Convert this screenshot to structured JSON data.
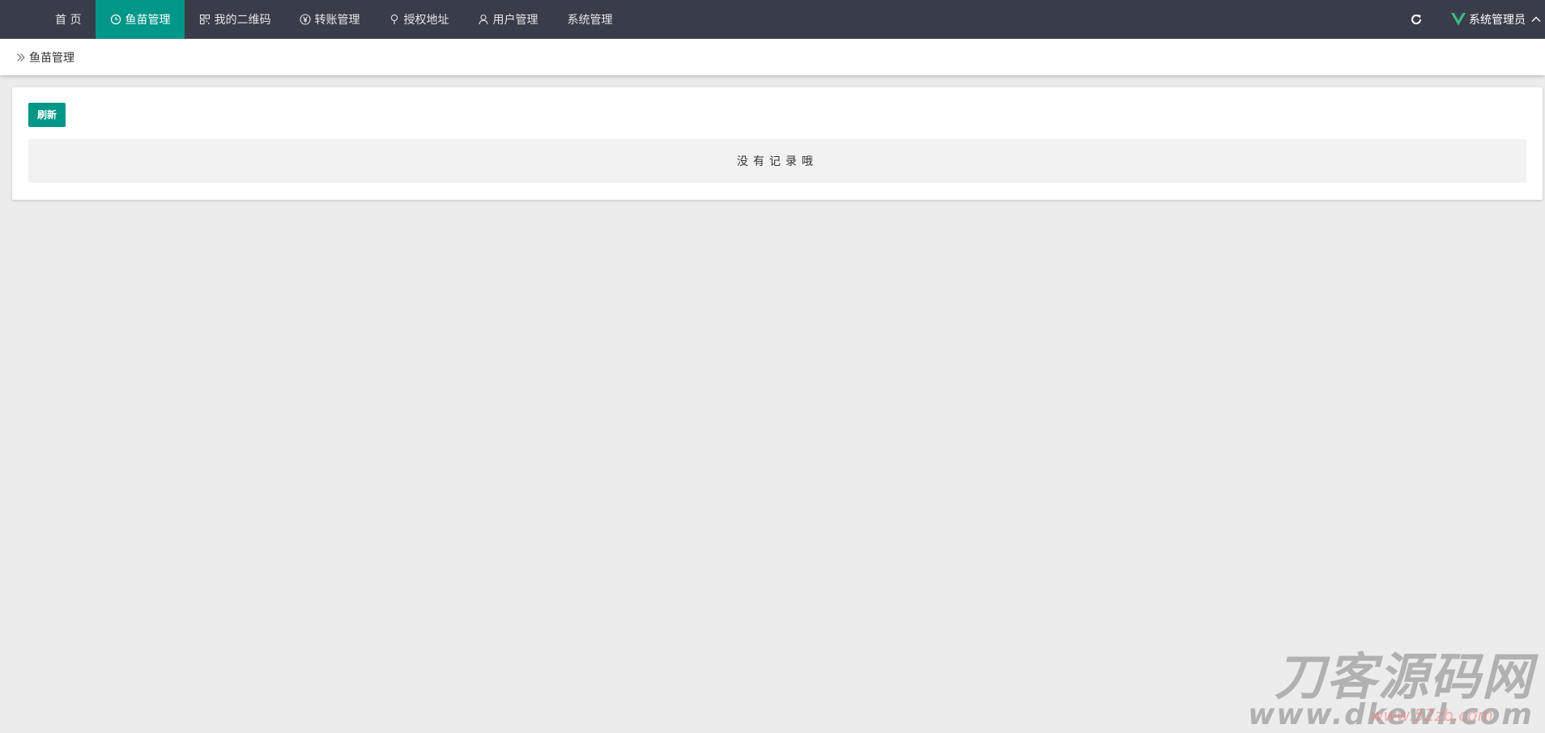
{
  "nav": {
    "items": [
      {
        "label": "首 页",
        "icon": "none"
      },
      {
        "label": "鱼苗管理",
        "icon": "clock-icon",
        "active": true
      },
      {
        "label": "我的二维码",
        "icon": "qrcode-icon"
      },
      {
        "label": "转账管理",
        "icon": "yen-icon"
      },
      {
        "label": "授权地址",
        "icon": "location-icon"
      },
      {
        "label": "用户管理",
        "icon": "user-icon"
      },
      {
        "label": "系统管理",
        "icon": "none"
      }
    ]
  },
  "user": {
    "name": "系统管理员"
  },
  "breadcrumb": {
    "current": "鱼苗管理"
  },
  "toolbar": {
    "refresh_label": "刷新"
  },
  "table": {
    "empty_text": "没有记录哦"
  },
  "watermark": {
    "title": "刀客源码网",
    "url": "www.dkewl.com",
    "url_overlay": "www.52zb.com"
  },
  "colors": {
    "topbar": "#393d49",
    "accent": "#009688",
    "background": "#ececec",
    "brand_logo": "#42b983"
  }
}
